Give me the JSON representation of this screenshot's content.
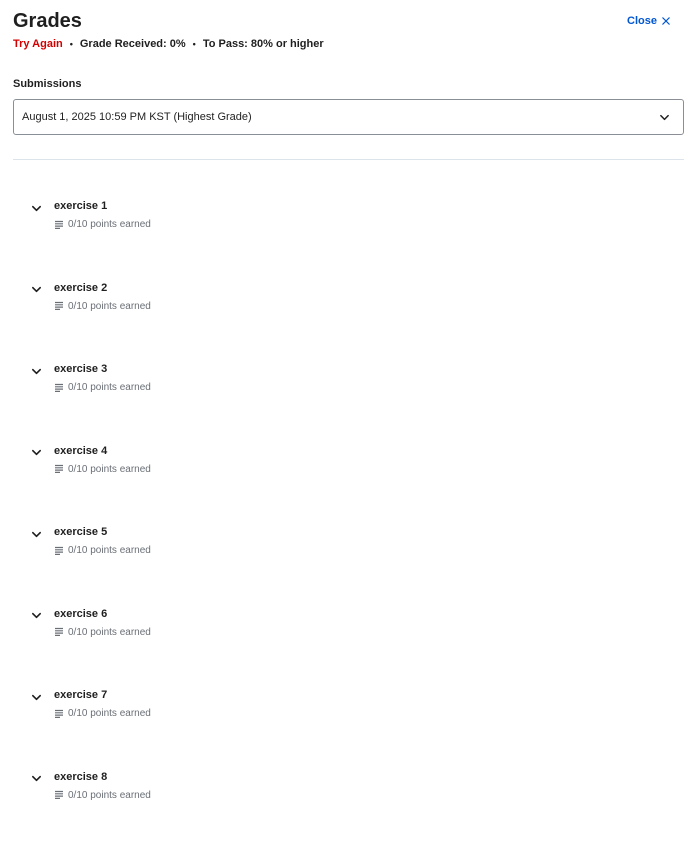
{
  "header": {
    "title": "Grades",
    "close_label": "Close",
    "status": "Try Again",
    "grade_received": "Grade Received: 0%",
    "to_pass": "To Pass: 80% or higher",
    "separator": "•"
  },
  "submissions": {
    "label": "Submissions",
    "selected": "August 1, 2025 10:59 PM KST (Highest Grade)"
  },
  "exercises": [
    {
      "name": "exercise 1",
      "points": "0/10 points earned"
    },
    {
      "name": "exercise 2",
      "points": "0/10 points earned"
    },
    {
      "name": "exercise 3",
      "points": "0/10 points earned"
    },
    {
      "name": "exercise 4",
      "points": "0/10 points earned"
    },
    {
      "name": "exercise 5",
      "points": "0/10 points earned"
    },
    {
      "name": "exercise 6",
      "points": "0/10 points earned"
    },
    {
      "name": "exercise 7",
      "points": "0/10 points earned"
    },
    {
      "name": "exercise 8",
      "points": "0/10 points earned"
    }
  ],
  "colors": {
    "accent": "#0056d2",
    "fail": "#d30001",
    "muted": "#6a6f76"
  }
}
